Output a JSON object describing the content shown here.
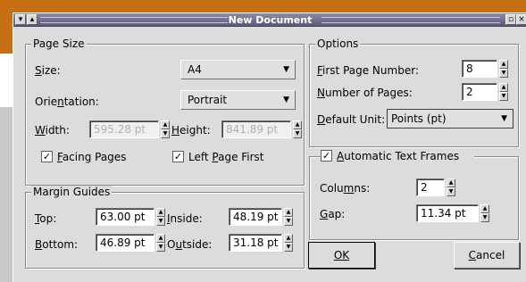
{
  "window": {
    "title": "New Document"
  },
  "page_size": {
    "legend": "Page Size",
    "size_label": "Size:",
    "size_value": "A4",
    "orientation_label": "Orientation:",
    "orientation_value": "Portrait",
    "width_label": "Width:",
    "width_value": "595.28 pt",
    "height_label": "Height:",
    "height_value": "841.89 pt",
    "facing_pages_label": "Facing Pages",
    "facing_pages_checked": true,
    "left_page_first_label": "Left Page First",
    "left_page_first_checked": true
  },
  "margins": {
    "legend": "Margin Guides",
    "top_label": "Top:",
    "top_value": "63.00 pt",
    "bottom_label": "Bottom:",
    "bottom_value": "46.89 pt",
    "inside_label": "Inside:",
    "inside_value": "48.19 pt",
    "outside_label": "Outside:",
    "outside_value": "31.18 pt"
  },
  "options": {
    "legend": "Options",
    "first_page_label": "First Page Number:",
    "first_page_value": "8",
    "num_pages_label": "Number of Pages:",
    "num_pages_value": "2",
    "default_unit_label": "Default Unit:",
    "default_unit_value": "Points (pt)"
  },
  "text_frames": {
    "legend": "Automatic Text Frames",
    "checked": true,
    "columns_label": "Columns:",
    "columns_value": "2",
    "gap_label": "Gap:",
    "gap_value": "11.34 pt"
  },
  "buttons": {
    "ok": "OK",
    "cancel": "Cancel"
  },
  "icons": {
    "check_mark": "✓",
    "spin_up": "▲",
    "spin_down": "▼",
    "combo_arrow": "▼"
  }
}
